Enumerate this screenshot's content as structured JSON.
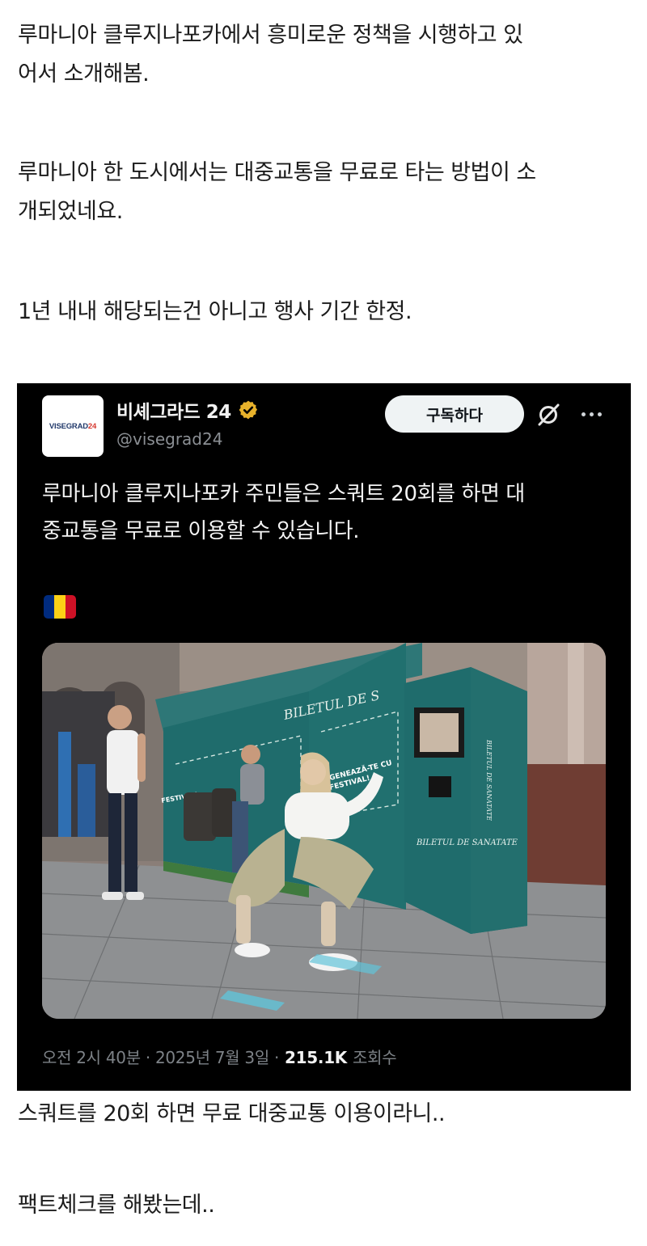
{
  "post": {
    "paragraphs": [
      [
        "루마니아 클루지나포카에서 흥미로운 정책을 시행하고 있",
        "어서 소개해봄."
      ],
      [
        "루마니아 한 도시에서는 대중교통을 무료로 타는 방법이 소",
        "개되었네요."
      ],
      [
        "1년 내내 해당되는건 아니고 행사 기간 한정."
      ]
    ],
    "after_tweet": [
      "스쿼트를 20회 하면 무료 대중교통 이용이라니..",
      "팩트체크를 해봤는데.."
    ]
  },
  "tweet": {
    "avatar_text": "VISEGRAD",
    "avatar_text_num": "24",
    "display_name": "비셰그라드 24",
    "handle": "@visegrad24",
    "subscribe_label": "구독하다",
    "text_lines": [
      "루마니아 클루지나포카 주민들은 스쿼트 20회를 하면 대",
      "중교통을 무료로 이용할 수 있습니다."
    ],
    "flag_colors": [
      "#002B7F",
      "#FCD116",
      "#CE1126"
    ],
    "photo_signs": {
      "booth_top": "BILETUL DE S",
      "booth_mid": "GENEAZĂ-TE CU",
      "booth_mid2": "FESTIVAL!",
      "booth_left": "FESTIVAL!",
      "kiosk_side": "BILETUL DE SANATATE",
      "kiosk_front": "BILETUL DE SANATATE"
    },
    "timestamp": "오전 2시 40분 · 2025년 7월 3일 ·",
    "views_count": "215.1K",
    "views_label": "조회수"
  },
  "colors": {
    "verified_badge": "#E8B22B",
    "tweet_bg": "#000000",
    "booth_teal": "#1f6c6c"
  }
}
